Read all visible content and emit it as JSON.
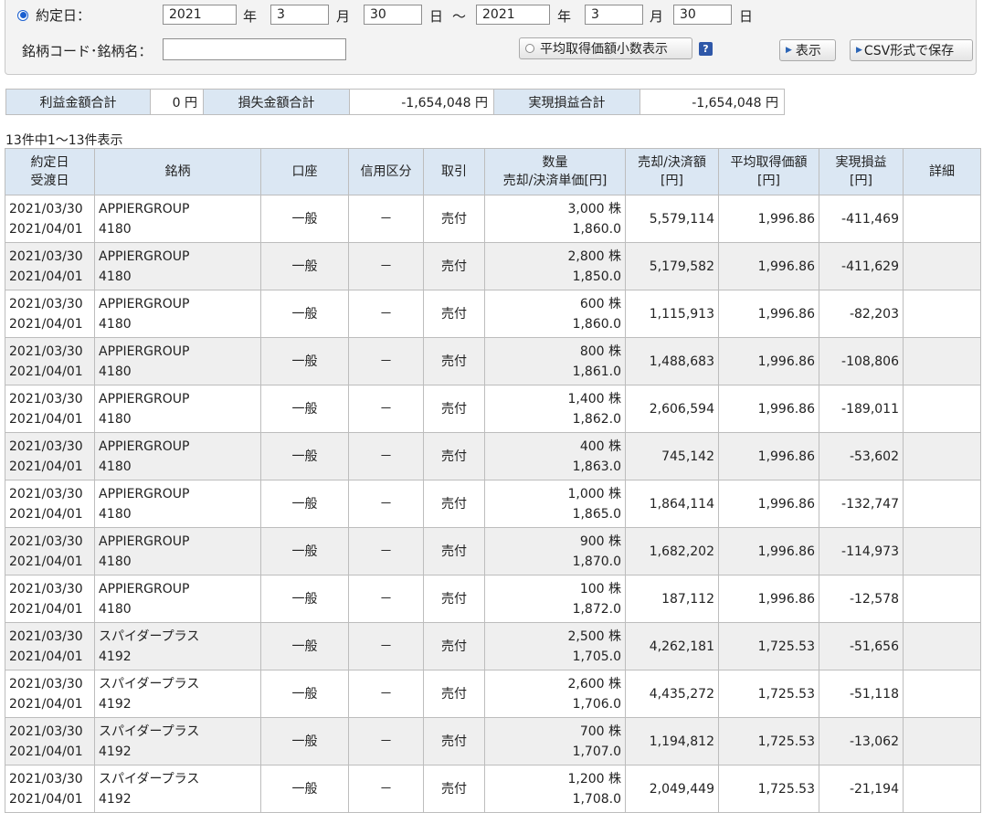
{
  "filter": {
    "date_label": "約定日：",
    "from": {
      "year": "2021",
      "month": "3",
      "day": "30"
    },
    "to": {
      "year": "2021",
      "month": "3",
      "day": "30"
    },
    "unit_year": "年",
    "unit_month": "月",
    "unit_day": "日",
    "tilde": "～",
    "code_label": "銘柄コード･銘柄名：",
    "code_value": "",
    "avg_decimal_label": "平均取得価額小数表示",
    "help": "?",
    "show_label": "表示",
    "csv_label": "CSV形式で保存"
  },
  "summary": {
    "profit_label": "利益金額合計",
    "profit_value": "0 円",
    "loss_label": "損失金額合計",
    "loss_value": "-1,654,048 円",
    "realized_label": "実現損益合計",
    "realized_value": "-1,654,048 円"
  },
  "count_text": "13件中1～13件表示",
  "table": {
    "headers": {
      "date1": "約定日",
      "date2": "受渡日",
      "stock": "銘柄",
      "account": "口座",
      "credit": "信用区分",
      "trade": "取引",
      "qty1": "数量",
      "qty2": "売却/決済単価[円]",
      "amount1": "売却/決済額",
      "amount2": "[円]",
      "avg1": "平均取得価額",
      "avg2": "[円]",
      "pl1": "実現損益",
      "pl2": "[円]",
      "detail": "詳細"
    },
    "rows": [
      {
        "trade_date": "2021/03/30",
        "settle_date": "2021/04/01",
        "name": "APPIERGROUP",
        "code": "4180",
        "account": "一般",
        "credit": "－",
        "trade": "売付",
        "qty": "3,000 株",
        "price": "1,860.0",
        "amount": "5,579,114",
        "avg": "1,996.86",
        "pl": "-411,469"
      },
      {
        "trade_date": "2021/03/30",
        "settle_date": "2021/04/01",
        "name": "APPIERGROUP",
        "code": "4180",
        "account": "一般",
        "credit": "－",
        "trade": "売付",
        "qty": "2,800 株",
        "price": "1,850.0",
        "amount": "5,179,582",
        "avg": "1,996.86",
        "pl": "-411,629"
      },
      {
        "trade_date": "2021/03/30",
        "settle_date": "2021/04/01",
        "name": "APPIERGROUP",
        "code": "4180",
        "account": "一般",
        "credit": "－",
        "trade": "売付",
        "qty": "600 株",
        "price": "1,860.0",
        "amount": "1,115,913",
        "avg": "1,996.86",
        "pl": "-82,203"
      },
      {
        "trade_date": "2021/03/30",
        "settle_date": "2021/04/01",
        "name": "APPIERGROUP",
        "code": "4180",
        "account": "一般",
        "credit": "－",
        "trade": "売付",
        "qty": "800 株",
        "price": "1,861.0",
        "amount": "1,488,683",
        "avg": "1,996.86",
        "pl": "-108,806"
      },
      {
        "trade_date": "2021/03/30",
        "settle_date": "2021/04/01",
        "name": "APPIERGROUP",
        "code": "4180",
        "account": "一般",
        "credit": "－",
        "trade": "売付",
        "qty": "1,400 株",
        "price": "1,862.0",
        "amount": "2,606,594",
        "avg": "1,996.86",
        "pl": "-189,011"
      },
      {
        "trade_date": "2021/03/30",
        "settle_date": "2021/04/01",
        "name": "APPIERGROUP",
        "code": "4180",
        "account": "一般",
        "credit": "－",
        "trade": "売付",
        "qty": "400 株",
        "price": "1,863.0",
        "amount": "745,142",
        "avg": "1,996.86",
        "pl": "-53,602"
      },
      {
        "trade_date": "2021/03/30",
        "settle_date": "2021/04/01",
        "name": "APPIERGROUP",
        "code": "4180",
        "account": "一般",
        "credit": "－",
        "trade": "売付",
        "qty": "1,000 株",
        "price": "1,865.0",
        "amount": "1,864,114",
        "avg": "1,996.86",
        "pl": "-132,747"
      },
      {
        "trade_date": "2021/03/30",
        "settle_date": "2021/04/01",
        "name": "APPIERGROUP",
        "code": "4180",
        "account": "一般",
        "credit": "－",
        "trade": "売付",
        "qty": "900 株",
        "price": "1,870.0",
        "amount": "1,682,202",
        "avg": "1,996.86",
        "pl": "-114,973"
      },
      {
        "trade_date": "2021/03/30",
        "settle_date": "2021/04/01",
        "name": "APPIERGROUP",
        "code": "4180",
        "account": "一般",
        "credit": "－",
        "trade": "売付",
        "qty": "100 株",
        "price": "1,872.0",
        "amount": "187,112",
        "avg": "1,996.86",
        "pl": "-12,578"
      },
      {
        "trade_date": "2021/03/30",
        "settle_date": "2021/04/01",
        "name": "スパイダープラス",
        "code": "4192",
        "account": "一般",
        "credit": "－",
        "trade": "売付",
        "qty": "2,500 株",
        "price": "1,705.0",
        "amount": "4,262,181",
        "avg": "1,725.53",
        "pl": "-51,656"
      },
      {
        "trade_date": "2021/03/30",
        "settle_date": "2021/04/01",
        "name": "スパイダープラス",
        "code": "4192",
        "account": "一般",
        "credit": "－",
        "trade": "売付",
        "qty": "2,600 株",
        "price": "1,706.0",
        "amount": "4,435,272",
        "avg": "1,725.53",
        "pl": "-51,118"
      },
      {
        "trade_date": "2021/03/30",
        "settle_date": "2021/04/01",
        "name": "スパイダープラス",
        "code": "4192",
        "account": "一般",
        "credit": "－",
        "trade": "売付",
        "qty": "700 株",
        "price": "1,707.0",
        "amount": "1,194,812",
        "avg": "1,725.53",
        "pl": "-13,062"
      },
      {
        "trade_date": "2021/03/30",
        "settle_date": "2021/04/01",
        "name": "スパイダープラス",
        "code": "4192",
        "account": "一般",
        "credit": "－",
        "trade": "売付",
        "qty": "1,200 株",
        "price": "1,708.0",
        "amount": "2,049,449",
        "avg": "1,725.53",
        "pl": "-21,194"
      }
    ]
  }
}
